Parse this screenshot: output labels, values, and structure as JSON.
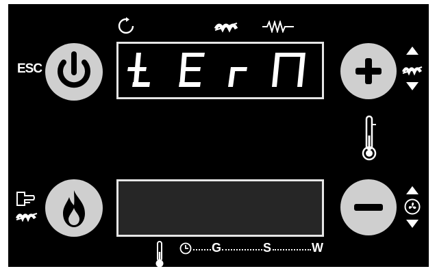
{
  "esc_label": "ESC",
  "display_upper": {
    "text": "tErn"
  },
  "display_lower": {
    "text": ""
  },
  "timeline": {
    "g": "G",
    "s": "S",
    "w": "W"
  },
  "colors": {
    "panel": "#000000",
    "button": "#cfcfcf",
    "segment": "#ffffff",
    "display_lower_bg": "#262626"
  },
  "icons": [
    "refresh-icon",
    "auger-icon",
    "resistor-icon",
    "power-icon",
    "plus-icon",
    "minus-icon",
    "thermometer-icon",
    "fire-icon",
    "hand-pointer-icon",
    "fan-icon",
    "clock-icon",
    "up-arrow-icon",
    "down-arrow-icon"
  ]
}
